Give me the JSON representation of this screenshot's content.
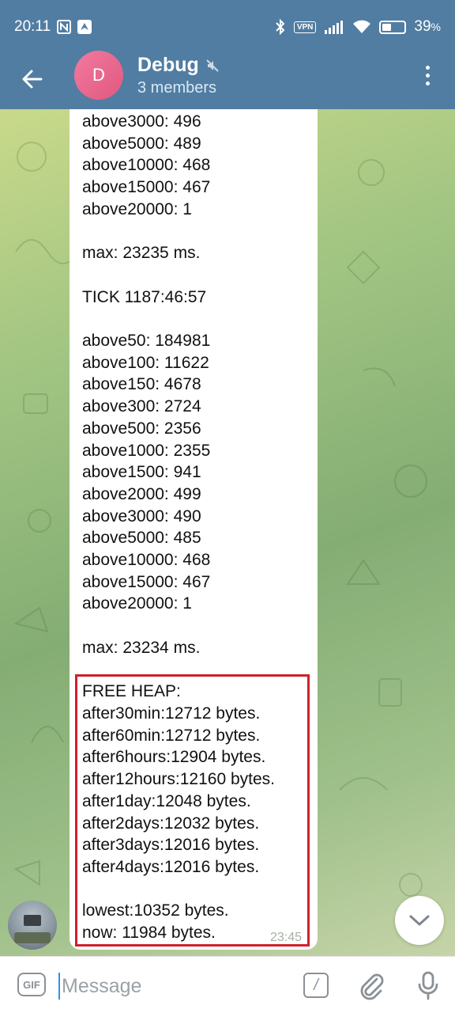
{
  "status": {
    "time": "20:11",
    "vpn": "VPN",
    "battery": "39",
    "battery_unit": "%",
    "battery_level": 0.39
  },
  "header": {
    "avatar_letter": "D",
    "title": "Debug",
    "subtitle": "3 members"
  },
  "message": {
    "text": "above3000: 496\nabove5000: 489\nabove10000: 468\nabove15000: 467\nabove20000: 1\n\nmax: 23235 ms.\n\nTICK 1187:46:57\n\nabove50: 184981\nabove100: 11622\nabove150: 4678\nabove300: 2724\nabove500: 2356\nabove1000: 2355\nabove1500: 941\nabove2000: 499\nabove3000: 490\nabove5000: 485\nabove10000: 468\nabove15000: 467\nabove20000: 1\n\nmax: 23234 ms.\n\nFREE HEAP:\nafter30min:12712 bytes.\nafter60min:12712 bytes.\nafter6hours:12904 bytes.\nafter12hours:12160 bytes.\nafter1day:12048 bytes.\nafter2days:12032 bytes.\nafter3days:12016 bytes.\nafter4days:12016 bytes.\n\nlowest:10352 bytes.\nnow: 11984 bytes.",
    "time": "23:45",
    "highlight_color": "#d0202a"
  },
  "input": {
    "gif_label": "GIF",
    "placeholder": "Message",
    "value": "",
    "command_label": "/"
  },
  "colors": {
    "header": "#517da2",
    "accent": "#3390ec"
  }
}
